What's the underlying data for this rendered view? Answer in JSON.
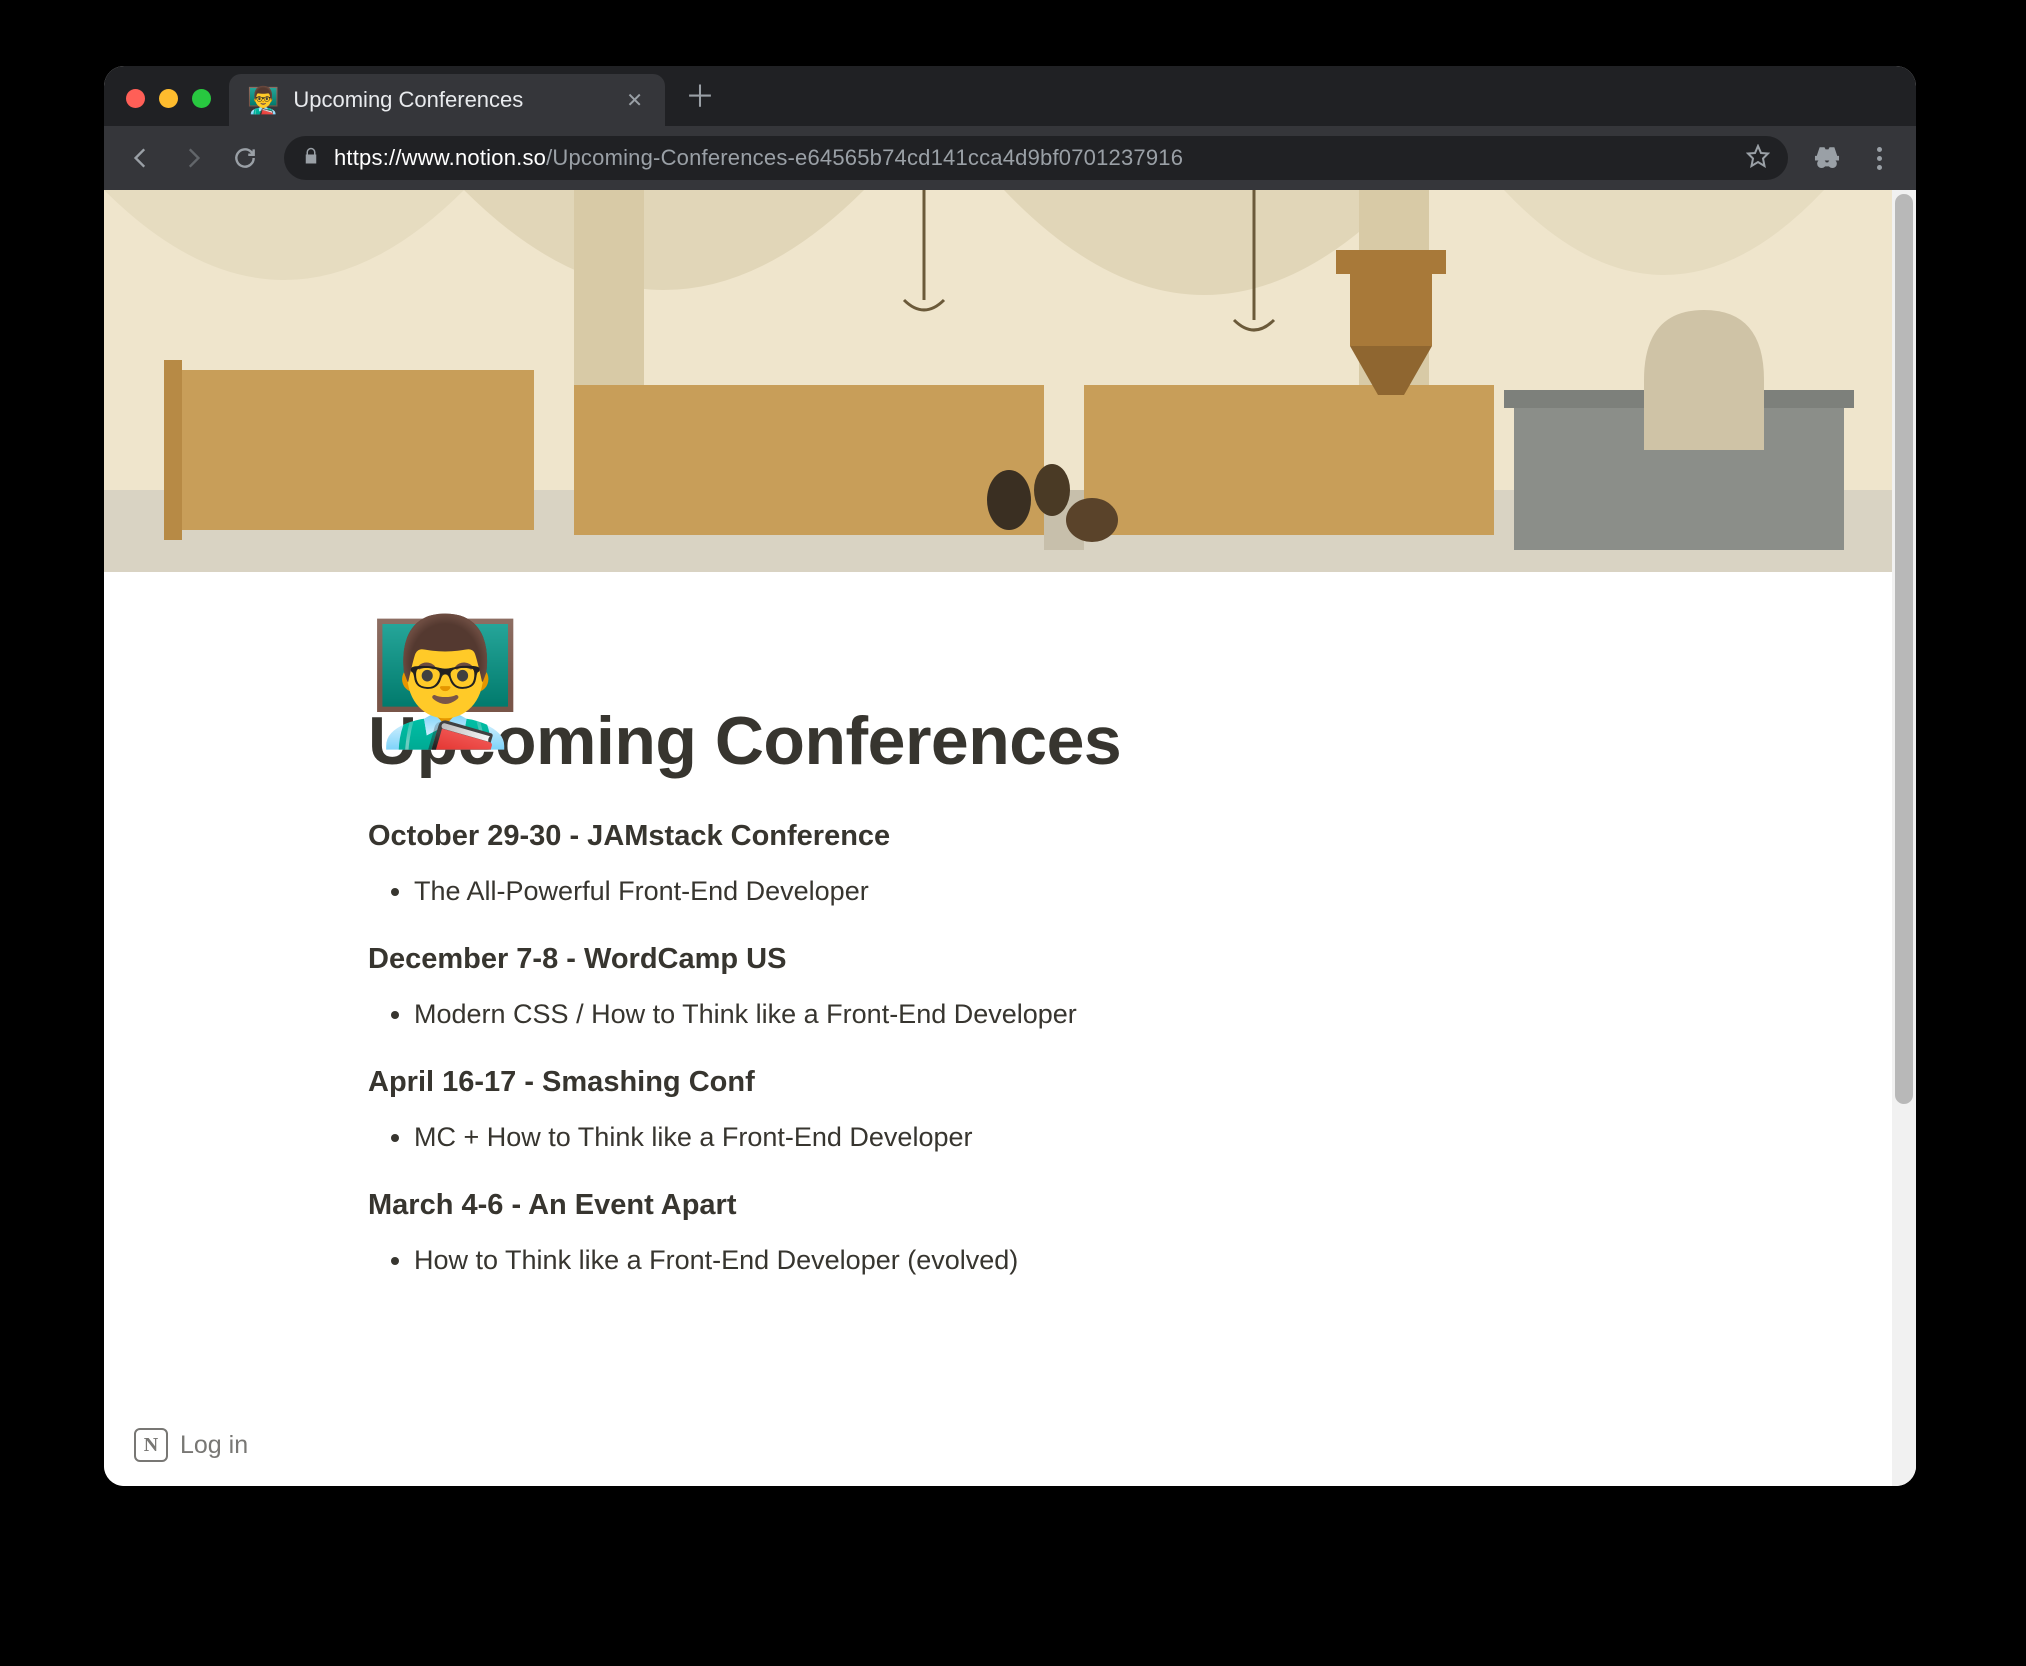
{
  "browser": {
    "tab": {
      "favicon": "👨‍🏫",
      "title": "Upcoming Conferences"
    },
    "url_host": "https://www.notion.so",
    "url_path": "/Upcoming-Conferences-e64565b74cd141cca4d9bf0701237916"
  },
  "page": {
    "icon": "👨‍🏫",
    "title": "Upcoming Conferences",
    "conferences": [
      {
        "heading": "October 29-30 - JAMstack Conference",
        "talks": [
          "The All-Powerful Front-End Developer"
        ]
      },
      {
        "heading": "December 7-8 - WordCamp US",
        "talks": [
          "Modern CSS / How to Think like a Front-End Developer"
        ]
      },
      {
        "heading": "April 16-17 - Smashing Conf",
        "talks": [
          "MC + How to Think like a Front-End Developer"
        ]
      },
      {
        "heading": "March 4-6 - An Event Apart",
        "talks": [
          "How to Think like a Front-End Developer (evolved)"
        ]
      }
    ],
    "login_label": "Log in"
  }
}
